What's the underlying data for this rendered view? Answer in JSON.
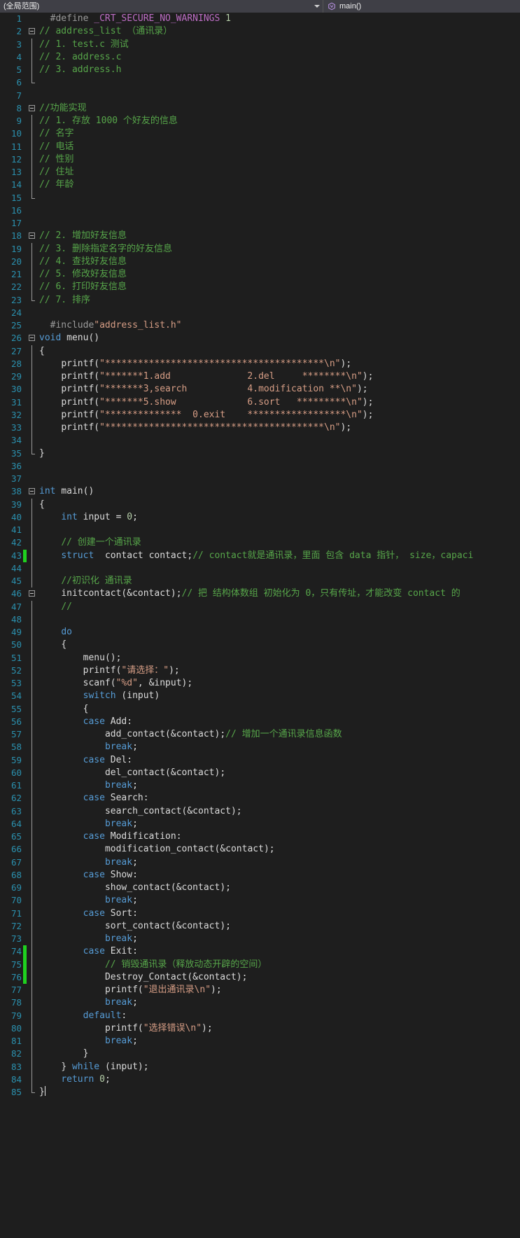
{
  "nav": {
    "scope_label": "(全局范围)",
    "scope_caret_icon": "chevron-down-icon",
    "member_label": "main()",
    "member_icon": "method-icon"
  },
  "editor": {
    "first_line": 1,
    "last_line": 85,
    "changed_lines": [
      43,
      74,
      75,
      76
    ],
    "lines": [
      {
        "n": 1,
        "fold": "none",
        "text": "  #define _CRT_SECURE_NO_WARNINGS 1"
      },
      {
        "n": 2,
        "fold": "start",
        "text": "// address_list （通讯录）"
      },
      {
        "n": 3,
        "fold": "line",
        "text": "// 1. test.c 测试"
      },
      {
        "n": 4,
        "fold": "line",
        "text": "// 2. address.c"
      },
      {
        "n": 5,
        "fold": "line",
        "text": "// 3. address.h"
      },
      {
        "n": 6,
        "fold": "end",
        "text": ""
      },
      {
        "n": 7,
        "fold": "none",
        "text": ""
      },
      {
        "n": 8,
        "fold": "start",
        "text": "//功能实现"
      },
      {
        "n": 9,
        "fold": "line",
        "text": "// 1. 存放 1000 个好友的信息"
      },
      {
        "n": 10,
        "fold": "line",
        "text": "// 名字"
      },
      {
        "n": 11,
        "fold": "line",
        "text": "// 电话"
      },
      {
        "n": 12,
        "fold": "line",
        "text": "// 性别"
      },
      {
        "n": 13,
        "fold": "line",
        "text": "// 住址"
      },
      {
        "n": 14,
        "fold": "line",
        "text": "// 年龄"
      },
      {
        "n": 15,
        "fold": "end",
        "text": ""
      },
      {
        "n": 16,
        "fold": "none",
        "text": ""
      },
      {
        "n": 17,
        "fold": "none",
        "text": ""
      },
      {
        "n": 18,
        "fold": "start",
        "text": "// 2. 增加好友信息"
      },
      {
        "n": 19,
        "fold": "line",
        "text": "// 3. 删除指定名字的好友信息"
      },
      {
        "n": 20,
        "fold": "line",
        "text": "// 4. 查找好友信息"
      },
      {
        "n": 21,
        "fold": "line",
        "text": "// 5. 修改好友信息"
      },
      {
        "n": 22,
        "fold": "line",
        "text": "// 6. 打印好友信息"
      },
      {
        "n": 23,
        "fold": "end",
        "text": "// 7. 排序"
      },
      {
        "n": 24,
        "fold": "none",
        "text": ""
      },
      {
        "n": 25,
        "fold": "none",
        "text": "  #include\"address_list.h\""
      },
      {
        "n": 26,
        "fold": "start",
        "text": "void menu()"
      },
      {
        "n": 27,
        "fold": "line",
        "text": "{"
      },
      {
        "n": 28,
        "fold": "line",
        "text": "    printf(\"****************************************\\n\");"
      },
      {
        "n": 29,
        "fold": "line",
        "text": "    printf(\"*******1.add              2.del     ********\\n\");"
      },
      {
        "n": 30,
        "fold": "line",
        "text": "    printf(\"*******3,search           4.modification **\\n\");"
      },
      {
        "n": 31,
        "fold": "line",
        "text": "    printf(\"*******5.show             6.sort   *********\\n\");"
      },
      {
        "n": 32,
        "fold": "line",
        "text": "    printf(\"**************  0.exit    ******************\\n\");"
      },
      {
        "n": 33,
        "fold": "line",
        "text": "    printf(\"****************************************\\n\");"
      },
      {
        "n": 34,
        "fold": "line",
        "text": ""
      },
      {
        "n": 35,
        "fold": "end",
        "text": "}"
      },
      {
        "n": 36,
        "fold": "none",
        "text": ""
      },
      {
        "n": 37,
        "fold": "none",
        "text": ""
      },
      {
        "n": 38,
        "fold": "start",
        "text": "int main()"
      },
      {
        "n": 39,
        "fold": "line",
        "text": "{"
      },
      {
        "n": 40,
        "fold": "line",
        "text": "    int input = 0;"
      },
      {
        "n": 41,
        "fold": "line",
        "text": ""
      },
      {
        "n": 42,
        "fold": "line",
        "text": "    // 创建一个通讯录"
      },
      {
        "n": 43,
        "fold": "line",
        "text": "    struct  contact contact;// contact就是通讯录，里面 包含 data 指针， size，capaci"
      },
      {
        "n": 44,
        "fold": "line",
        "text": ""
      },
      {
        "n": 45,
        "fold": "line",
        "text": "    //初识化 通讯录"
      },
      {
        "n": 46,
        "fold": "start2",
        "text": "    initcontact(&contact);// 把 结构体数组 初始化为 0，只有传址，才能改变 contact 的"
      },
      {
        "n": 47,
        "fold": "line",
        "text": "    //"
      },
      {
        "n": 48,
        "fold": "line",
        "text": ""
      },
      {
        "n": 49,
        "fold": "line",
        "text": "    do"
      },
      {
        "n": 50,
        "fold": "line",
        "text": "    {"
      },
      {
        "n": 51,
        "fold": "line",
        "text": "        menu();"
      },
      {
        "n": 52,
        "fold": "line",
        "text": "        printf(\"请选择：\");"
      },
      {
        "n": 53,
        "fold": "line",
        "text": "        scanf(\"%d\", &input);"
      },
      {
        "n": 54,
        "fold": "line",
        "text": "        switch (input)"
      },
      {
        "n": 55,
        "fold": "line",
        "text": "        {"
      },
      {
        "n": 56,
        "fold": "line",
        "text": "        case Add:"
      },
      {
        "n": 57,
        "fold": "line",
        "text": "            add_contact(&contact);// 增加一个通讯录信息函数"
      },
      {
        "n": 58,
        "fold": "line",
        "text": "            break;"
      },
      {
        "n": 59,
        "fold": "line",
        "text": "        case Del:"
      },
      {
        "n": 60,
        "fold": "line",
        "text": "            del_contact(&contact);"
      },
      {
        "n": 61,
        "fold": "line",
        "text": "            break;"
      },
      {
        "n": 62,
        "fold": "line",
        "text": "        case Search:"
      },
      {
        "n": 63,
        "fold": "line",
        "text": "            search_contact(&contact);"
      },
      {
        "n": 64,
        "fold": "line",
        "text": "            break;"
      },
      {
        "n": 65,
        "fold": "line",
        "text": "        case Modification:"
      },
      {
        "n": 66,
        "fold": "line",
        "text": "            modification_contact(&contact);"
      },
      {
        "n": 67,
        "fold": "line",
        "text": "            break;"
      },
      {
        "n": 68,
        "fold": "line",
        "text": "        case Show:"
      },
      {
        "n": 69,
        "fold": "line",
        "text": "            show_contact(&contact);"
      },
      {
        "n": 70,
        "fold": "line",
        "text": "            break;"
      },
      {
        "n": 71,
        "fold": "line",
        "text": "        case Sort:"
      },
      {
        "n": 72,
        "fold": "line",
        "text": "            sort_contact(&contact);"
      },
      {
        "n": 73,
        "fold": "line",
        "text": "            break;"
      },
      {
        "n": 74,
        "fold": "line",
        "text": "        case Exit:"
      },
      {
        "n": 75,
        "fold": "line",
        "text": "            // 销毁通讯录（释放动态开辟的空间）"
      },
      {
        "n": 76,
        "fold": "line",
        "text": "            Destroy_Contact(&contact);"
      },
      {
        "n": 77,
        "fold": "line",
        "text": "            printf(\"退出通讯录\\n\");"
      },
      {
        "n": 78,
        "fold": "line",
        "text": "            break;"
      },
      {
        "n": 79,
        "fold": "line",
        "text": "        default:"
      },
      {
        "n": 80,
        "fold": "line",
        "text": "            printf(\"选择错误\\n\");"
      },
      {
        "n": 81,
        "fold": "line",
        "text": "            break;"
      },
      {
        "n": 82,
        "fold": "line",
        "text": "        }"
      },
      {
        "n": 83,
        "fold": "line",
        "text": "    } while (input);"
      },
      {
        "n": 84,
        "fold": "line",
        "text": "    return 0;"
      },
      {
        "n": 85,
        "fold": "end",
        "text": "}"
      }
    ]
  },
  "colors": {
    "background": "#1e1e1e",
    "nav_background": "#3f3f46",
    "line_number": "#2b91af",
    "keyword": "#569cd6",
    "comment": "#57a64a",
    "string": "#d69d85",
    "number": "#b5cea8",
    "macro": "#be6ec6",
    "plain_text": "#dcdcdc",
    "change_marker": "#1fd11f"
  }
}
